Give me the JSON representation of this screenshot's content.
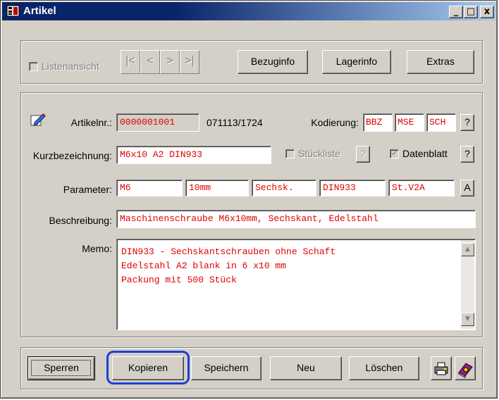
{
  "window": {
    "title": "Artikel",
    "minimize_glyph": "_",
    "maximize_glyph": "□",
    "close_glyph": "x"
  },
  "toolbar": {
    "list_view_label": "Listenansicht",
    "nav_first": "|<",
    "nav_prev": "<",
    "nav_next": ">",
    "nav_last": ">|",
    "bezuginfo_label": "Bezuginfo",
    "lagerinfo_label": "Lagerinfo",
    "extras_label": "Extras"
  },
  "form": {
    "article_no_label": "Artikelnr.:",
    "article_no": "0000001001",
    "timestamp": "071113/1724",
    "coding_label": "Kodierung:",
    "coding": [
      "BBZ",
      "MSE",
      "SCH"
    ],
    "help_glyph": "?",
    "short_desc_label": "Kurzbezeichnung:",
    "short_desc": "M6x10 A2 DIN933",
    "bom_label": "Stückliste",
    "bom_checked": false,
    "datasheet_label": "Datenblatt",
    "datasheet_checked": true,
    "check_glyph": "✓",
    "param_label": "Parameter:",
    "params": [
      "M6",
      "10mm",
      "Sechsk.",
      "DIN933",
      "St.V2A"
    ],
    "param_button": "A",
    "desc_label": "Beschreibung:",
    "description": "Maschinenschraube M6x10mm, Sechskant, Edelstahl",
    "memo_label": "Memo:",
    "memo_lines": [
      "DIN933 - Sechskantschrauben ohne Schaft",
      "Edelstahl A2 blank in 6 x10 mm",
      "Packung mit 500 Stück"
    ],
    "scroll_up": "▲",
    "scroll_down": "▼"
  },
  "actions": {
    "lock_label": "Sperren",
    "copy_label": "Kopieren",
    "save_label": "Speichern",
    "new_label": "Neu",
    "delete_label": "Löschen"
  },
  "colors": {
    "field_text": "#e00000",
    "title_bar": "#0a246a",
    "highlight": "#1a3fd6"
  }
}
